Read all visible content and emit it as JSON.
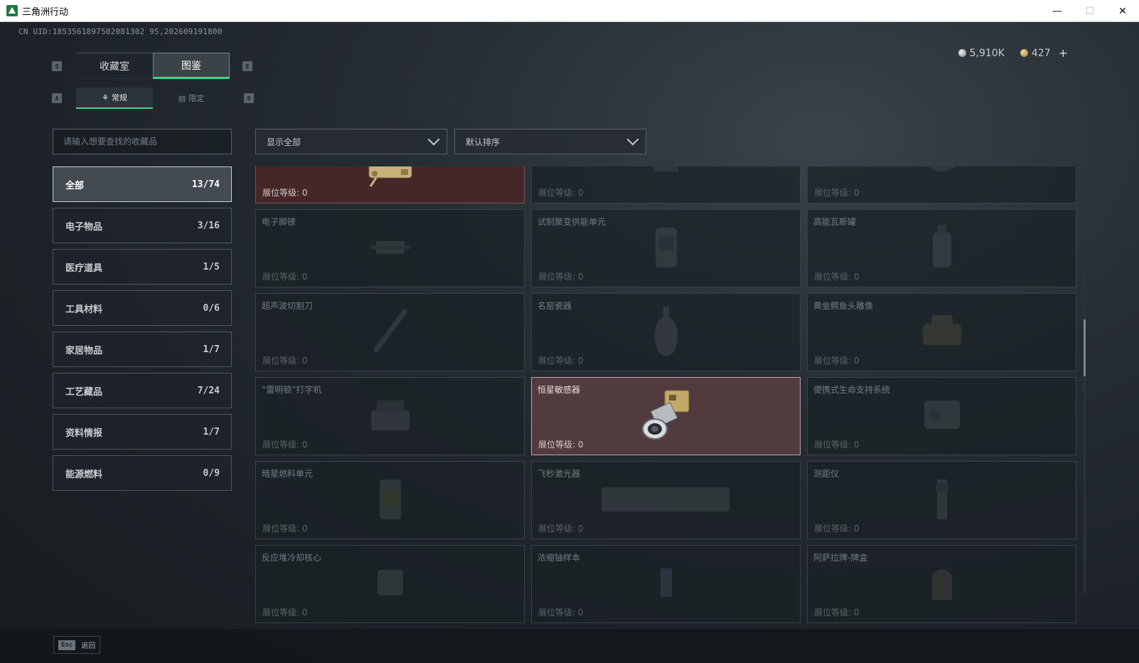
{
  "window": {
    "title": "三角洲行动"
  },
  "uid": "CN UID:1853561897502081302 95,202609191800",
  "currency": {
    "silver": "5,910K",
    "gold": "427",
    "plus": "+"
  },
  "keyhints": {
    "prev_tab": "Q",
    "next_tab": "E",
    "prev_sub": "A",
    "next_sub": "D"
  },
  "tabs": [
    {
      "label": "收藏室"
    },
    {
      "label": "图鉴"
    }
  ],
  "subtabs": [
    {
      "label": "常规"
    },
    {
      "label": "限定"
    }
  ],
  "search": {
    "placeholder": "请输入想要查找的收藏品"
  },
  "filter": {
    "value": "显示全部"
  },
  "sort": {
    "value": "默认排序"
  },
  "categories": [
    {
      "label": "全部",
      "count": "13/74"
    },
    {
      "label": "电子物品",
      "count": "3/16"
    },
    {
      "label": "医疗道具",
      "count": "1/5"
    },
    {
      "label": "工具材料",
      "count": "0/6"
    },
    {
      "label": "家居物品",
      "count": "1/7"
    },
    {
      "label": "工艺藏品",
      "count": "7/24"
    },
    {
      "label": "资料情报",
      "count": "1/7"
    },
    {
      "label": "能源燃料",
      "count": "0/9"
    }
  ],
  "level_label": "展位等级: 0",
  "items": [
    {
      "name": "",
      "level": "展位等级: 0"
    },
    {
      "name": "",
      "level": "展位等级: 0"
    },
    {
      "name": "",
      "level": "展位等级: 0"
    },
    {
      "name": "电子脚镣",
      "level": "展位等级: 0"
    },
    {
      "name": "试制聚变供能单元",
      "level": "展位等级: 0"
    },
    {
      "name": "高能瓦斯罐",
      "level": "展位等级: 0"
    },
    {
      "name": "超声波切割刀",
      "level": "展位等级: 0"
    },
    {
      "name": "名窑瓷器",
      "level": "展位等级: 0"
    },
    {
      "name": "黄金鳄鱼头雕像",
      "level": "展位等级: 0"
    },
    {
      "name": "“雷明顿”打字机",
      "level": "展位等级: 0"
    },
    {
      "name": "恒星敏感器",
      "level": "展位等级: 0"
    },
    {
      "name": "便携式生命支持系统",
      "level": "展位等级: 0"
    },
    {
      "name": "暗星燃料单元",
      "level": "展位等级: 0"
    },
    {
      "name": "飞秒激光器",
      "level": "展位等级: 0"
    },
    {
      "name": "测距仪",
      "level": "展位等级: 0"
    },
    {
      "name": "反应堆冷却核心",
      "level": "展位等级: 0"
    },
    {
      "name": "浓缩铀样本",
      "level": "展位等级: 0"
    },
    {
      "name": "阿萨拉牌-牌盒",
      "level": "展位等级: 0"
    }
  ],
  "bottom": {
    "esc_key": "Esc",
    "esc_label": "返回"
  },
  "colors": {
    "accent": "#3ed58a",
    "owned_card": "#4c3437"
  }
}
